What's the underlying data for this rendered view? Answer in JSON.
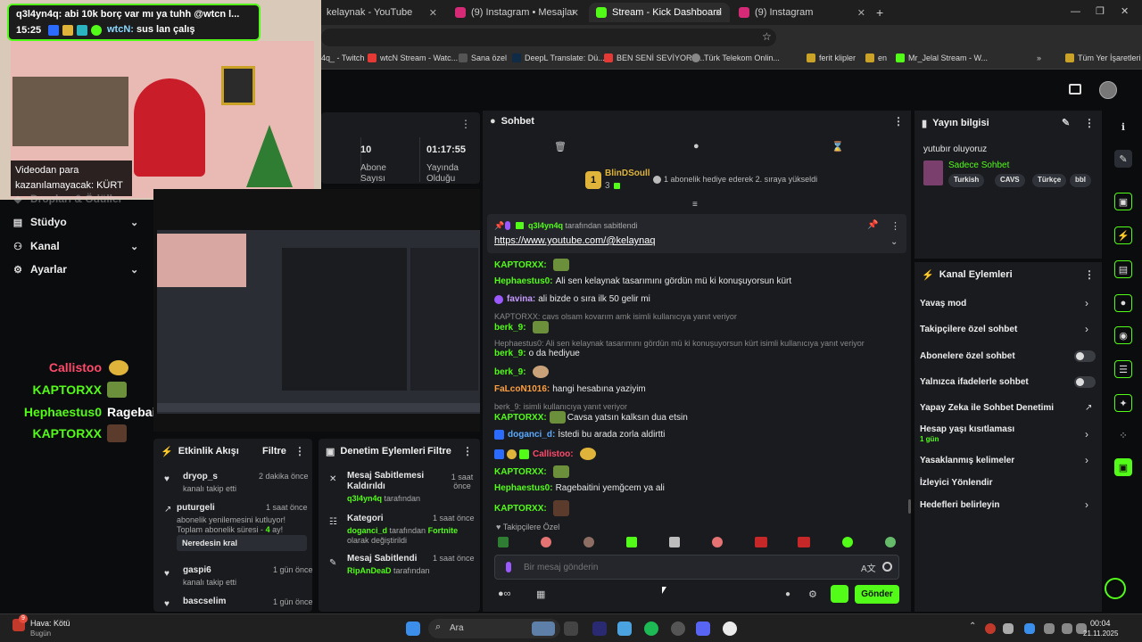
{
  "tabs": [
    {
      "label": "kelaynak - YouTube",
      "color": "#ff0000"
    },
    {
      "label": "(9) Instagram • Mesajlar",
      "color": "#d62976"
    },
    {
      "label": "Stream - Kick Dashboard",
      "color": "#53fc18"
    },
    {
      "label": "(9) Instagram",
      "color": "#d62976"
    }
  ],
  "new_tab": "+",
  "bookmarks": [
    "4q_ - Twitch",
    "wtcN Stream - Watc...",
    "Sana özel",
    "DeepL Translate: Dü...",
    "BEN SENİ SEVİYORU...",
    "Türk Telekom Onlin...",
    "ferit klipler",
    "en",
    "Mr_Jelal Stream - W...",
    "Tüm Yer İşaretleri"
  ],
  "stream_overlay": {
    "donation": "q3l4yn4q: abi 10k borç var mı ya tuhh @wtcn l...",
    "time": "15:25",
    "chat_user": "wtcN:",
    "chat_msg": "sus lan çalış",
    "caption": "Videodan para kazanılamayacak: KÜRT"
  },
  "nav": [
    {
      "label": "Stüdyo",
      "icon": "studio-icon"
    },
    {
      "label": "Kanal",
      "icon": "channel-icon"
    },
    {
      "label": "Ayarlar",
      "icon": "settings-icon"
    }
  ],
  "nav_partial": "Dropları & Ödüller",
  "overlay_chat": [
    {
      "user": "Callistoo",
      "color": "#ff4b6b",
      "msg": ""
    },
    {
      "user": "KAPTORXX",
      "color": "#53fc18",
      "msg": ""
    },
    {
      "user": "Hephaestus0",
      "color": "#53fc18",
      "msg": "Ragebaitini yemğcem ya ali"
    },
    {
      "user": "KAPTORXX",
      "color": "#53fc18",
      "msg": ""
    }
  ],
  "stats": [
    {
      "value": "10",
      "label": "Abone Sayısı"
    },
    {
      "value": "01:17:55",
      "label": "Yayında Olduğu"
    }
  ],
  "chat": {
    "title": "Sohbet",
    "gift_user": "BlinDSoull",
    "gift_count": "3",
    "gift_msg": "1 abonelik hediye ederek 2. sıraya yükseldi",
    "pinned_by": "q3l4yn4q",
    "pinned_suffix": "tarafından sabitlendi",
    "pinned_link": "https://www.youtube.com/@kelaynaq",
    "messages": [
      {
        "user": "KAPTORXX:",
        "color": "#53fc18",
        "text": "",
        "emote": "#6b8f3a"
      },
      {
        "user": "Hephaestus0:",
        "color": "#53fc18",
        "text": "Ali sen kelaynak tasarımını gördün mü ki konuşuyorsun kürt"
      },
      {
        "user": "favina:",
        "color": "#c79bff",
        "text": "ali bizde o sıra ilk 50 gelir mi"
      },
      {
        "user": "berk_9:",
        "color": "#53fc18",
        "text": "",
        "emote": "#6b8f3a"
      },
      {
        "user": "berk_9:",
        "color": "#53fc18",
        "text": "o da hediyue"
      },
      {
        "user": "berk_9:",
        "color": "#53fc18",
        "text": "",
        "emote": "#c9a27a"
      },
      {
        "user": "FaLcoN1016:",
        "color": "#ff9f40",
        "text": "hangi hesabına yaziyim"
      },
      {
        "user": "KAPTORXX:",
        "color": "#53fc18",
        "text": "Cavsa yatsın kalksın dua etsin",
        "emote": "#6b8f3a"
      },
      {
        "user": "doganci_d:",
        "color": "#5aa9ff",
        "text": "İstedi bu arada zorla aldirtti"
      },
      {
        "user": "Callistoo:",
        "color": "#ff4b6b",
        "text": "",
        "emote": "#e0b43a"
      },
      {
        "user": "KAPTORXX:",
        "color": "#53fc18",
        "text": "",
        "emote": "#6b8f3a"
      },
      {
        "user": "Hephaestus0:",
        "color": "#53fc18",
        "text": "Ragebaitini yemğcem ya ali"
      },
      {
        "user": "KAPTORXX:",
        "color": "#53fc18",
        "text": "",
        "emote": "#5a3b2c"
      }
    ],
    "replies": [
      "KAPTORXX: cavs olsam kovarım amk isimli kullanıcıya yanıt veriyor",
      "Hephaestus0: Ali sen kelaynak tasarımını gördün mü ki konuşuyorsun kürt isimli kullanıcıya yanıt veriyor",
      "berk_9: isimli kullanıcıya yanıt veriyor"
    ],
    "followers_only": "Takipçilere Özel",
    "placeholder": "Bir mesaj gönderin",
    "send": "Gönder"
  },
  "stream_info": {
    "title": "Yayın bilgisi",
    "stream_title": "yutubır oluyoruz",
    "category": "Sadece Sohbet",
    "tags": [
      "Turkish",
      "CAVS",
      "Türkçe",
      "bbl"
    ]
  },
  "channel_actions": {
    "title": "Kanal Eylemleri",
    "items": [
      {
        "label": "Yavaş mod",
        "kind": "chevron"
      },
      {
        "label": "Takipçilere özel sohbet",
        "kind": "chevron"
      },
      {
        "label": "Abonelere özel sohbet",
        "kind": "toggle"
      },
      {
        "label": "Yalnızca ifadelerle sohbet",
        "kind": "toggle"
      },
      {
        "label": "Yapay Zeka ile Sohbet Denetimi",
        "kind": "external"
      },
      {
        "label": "Hesap yaşı kısıtlaması",
        "kind": "chevron",
        "sub": "1 gün"
      },
      {
        "label": "Yasaklanmış kelimeler",
        "kind": "chevron"
      },
      {
        "label": "İzleyici Yönlendir",
        "kind": "none"
      },
      {
        "label": "Hedefleri belirleyin",
        "kind": "chevron"
      }
    ]
  },
  "activity": {
    "title": "Etkinlik Akışı",
    "filter": "Filtre",
    "items": [
      {
        "user": "dryop_s",
        "desc": "kanalı takip etti",
        "time": "2 dakika önce"
      },
      {
        "user": "puturgeli",
        "desc": "abonelik yenilemesini kutluyor! Toplam abonelik süresi -",
        "months": "4",
        "suffix": "ay!",
        "time": "1 saat önce",
        "note": "Neredesin kral"
      },
      {
        "user": "gaspi6",
        "desc": "kanalı takip etti",
        "time": "1 gün önce"
      },
      {
        "user": "bascselim",
        "desc": "",
        "time": "1 gün önce"
      }
    ]
  },
  "moderation": {
    "title": "Denetim Eylemleri",
    "filter": "Filtre",
    "items": [
      {
        "title": "Mesaj Sabitlemesi Kaldırıldı",
        "user": "q3l4yn4q",
        "suffix": "tarafından",
        "time": "1 saat önce"
      },
      {
        "title": "Kategori",
        "user": "doganci_d",
        "suffix": "tarafından",
        "extra": "Fortnite",
        "extra2": "olarak değiştirildi",
        "time": "1 saat önce"
      },
      {
        "title": "Mesaj Sabitlendi",
        "user": "RipAnDeaD",
        "suffix": "tarafından",
        "time": "1 saat önce"
      }
    ]
  },
  "taskbar": {
    "weather_title": "Hava: Kötü",
    "weather_sub": "Bugün",
    "weather_badge": "9",
    "search": "Ara",
    "time": "00:04",
    "date": "21.11.2025"
  }
}
